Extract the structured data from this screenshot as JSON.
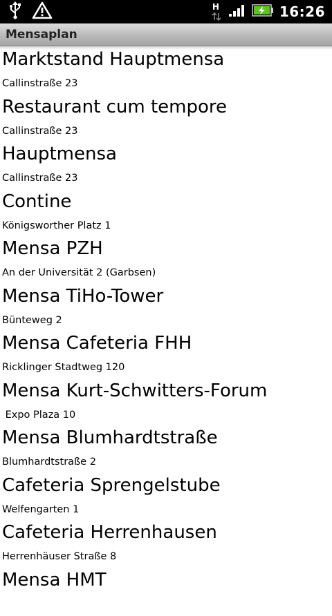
{
  "status_bar": {
    "time": "16:26",
    "network_letter": "H",
    "icons": [
      "usb-icon",
      "warning-icon",
      "network-h-icon",
      "signal-icon",
      "battery-charging-icon"
    ],
    "colors": {
      "background": "#000000",
      "battery": "#5cc51c"
    }
  },
  "title_bar": {
    "title": "Mensaplan"
  },
  "list": {
    "items": [
      {
        "name": "Marktstand Hauptmensa",
        "address": "Callinstraße 23"
      },
      {
        "name": "Restaurant cum tempore",
        "address": "Callinstraße 23"
      },
      {
        "name": "Hauptmensa",
        "address": "Callinstraße 23"
      },
      {
        "name": "Contine",
        "address": "Königsworther Platz 1"
      },
      {
        "name": "Mensa PZH",
        "address": "An der Universität 2 (Garbsen)"
      },
      {
        "name": "Mensa TiHo-Tower",
        "address": "Bünteweg 2"
      },
      {
        "name": "Mensa Cafeteria FHH",
        "address": "Ricklinger Stadtweg 120"
      },
      {
        "name": "Mensa Kurt-Schwitters-Forum",
        "address": " Expo Plaza 10"
      },
      {
        "name": "Mensa Blumhardtstraße",
        "address": "Blumhardtstraße 2"
      },
      {
        "name": "Cafeteria Sprengelstube",
        "address": "Welfengarten 1"
      },
      {
        "name": "Cafeteria Herrenhausen",
        "address": "Herrenhäuser Straße 8"
      },
      {
        "name": "Mensa HMT",
        "address": ""
      }
    ]
  }
}
